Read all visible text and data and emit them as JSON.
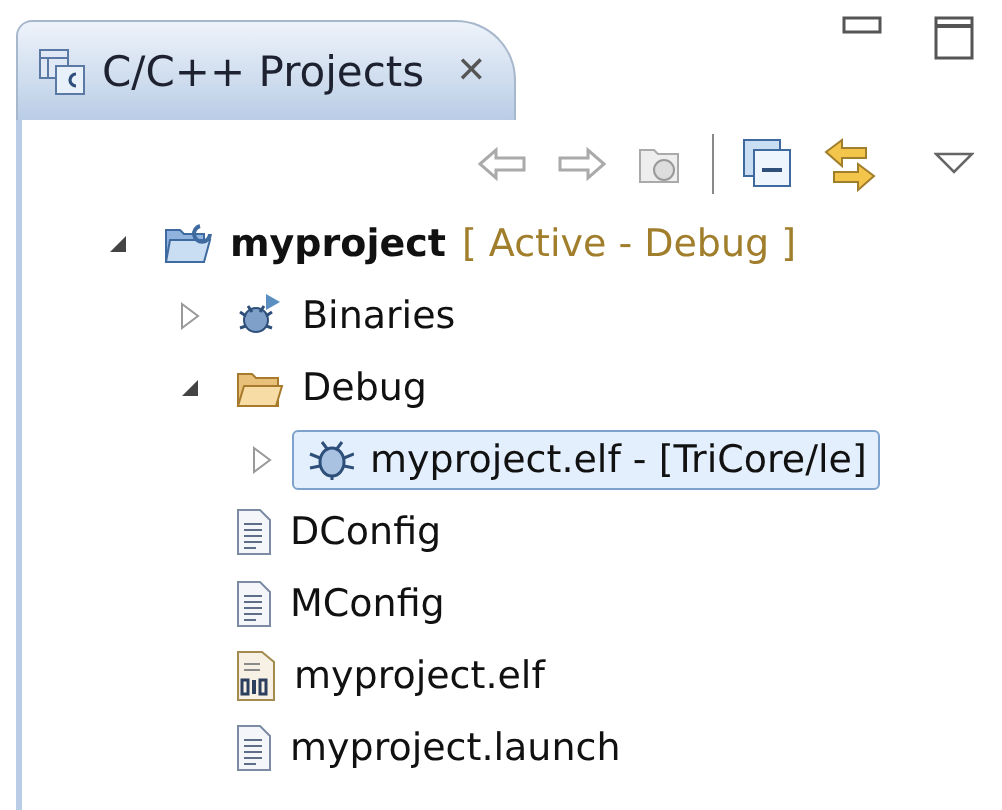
{
  "view": {
    "title": "C/C++ Projects",
    "close": "✕"
  },
  "tree": [
    {
      "label": "myproject",
      "decoration": "[ Active - Debug ]",
      "kind": "project",
      "expanded": true,
      "selected": false,
      "children": [
        {
          "label": "Binaries",
          "kind": "binaries",
          "expanded": false,
          "selected": false
        },
        {
          "label": "Debug",
          "kind": "folder",
          "expanded": true,
          "selected": false,
          "children": [
            {
              "label": "myproject.elf - [TriCore/le]",
              "kind": "executable",
              "expanded": false,
              "selected": true
            }
          ]
        },
        {
          "label": "DConfig",
          "kind": "text-file",
          "selected": false
        },
        {
          "label": "MConfig",
          "kind": "text-file",
          "selected": false
        },
        {
          "label": "myproject.elf",
          "kind": "binary-file",
          "selected": false
        },
        {
          "label": "myproject.launch",
          "kind": "text-file",
          "selected": false
        }
      ]
    }
  ]
}
